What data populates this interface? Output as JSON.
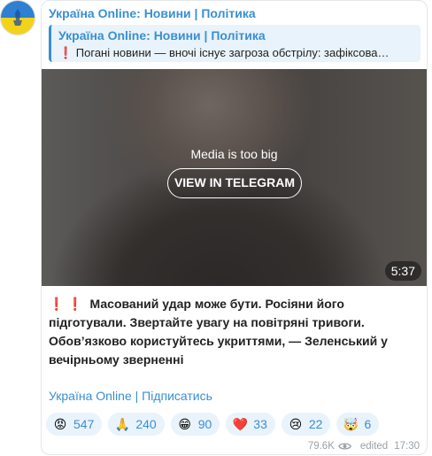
{
  "channel": {
    "name": "Україна Online: Новини | Політика"
  },
  "reply": {
    "title": "Україна Online: Новини | Політика",
    "text": "❗ Погані новини — вночі існує загроза обстрілу: зафіксова…"
  },
  "media": {
    "message": "Media is too big",
    "button_label": "VIEW IN TELEGRAM",
    "duration": "5:37"
  },
  "message": {
    "prefix": "❗ ❗",
    "text": "Масований удар може бути. Росіяни його підготували. Звертайте увагу на повітряні тривоги. Обов’язково користуйтесь укриттями, — Зеленський у вечірньому зверненні"
  },
  "footer_link": "Україна Online | Підписатись",
  "reactions": [
    {
      "emoji": "😡",
      "count": "547",
      "icon": "angry-face-icon"
    },
    {
      "emoji": "🙏",
      "count": "240",
      "icon": "folded-hands-icon"
    },
    {
      "emoji": "😁",
      "count": "90",
      "icon": "grinning-face-icon"
    },
    {
      "emoji": "❤️",
      "count": "33",
      "icon": "red-heart-icon"
    },
    {
      "emoji": "😢",
      "count": "22",
      "icon": "crying-face-icon"
    },
    {
      "emoji": "🤯",
      "count": "6",
      "icon": "exploding-head-icon"
    }
  ],
  "meta": {
    "views": "79.6K",
    "edited": "edited",
    "time": "17:30"
  },
  "colors": {
    "accent": "#3a8fd1",
    "reply_bg": "#e9f3fb",
    "alert": "#e0202a"
  }
}
